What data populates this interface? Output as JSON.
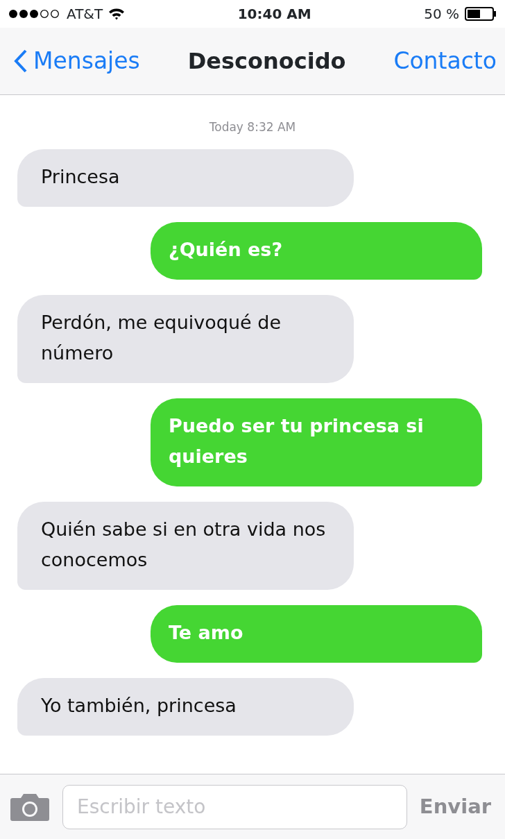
{
  "status_bar": {
    "carrier": "AT&T",
    "time": "10:40 AM",
    "battery": "50 %"
  },
  "nav": {
    "back": "Mensajes",
    "title": "Desconocido",
    "action": "Contacto"
  },
  "timestamp": "Today 8:32 AM",
  "messages": [
    {
      "kind": "incoming",
      "text": "Princesa"
    },
    {
      "kind": "outgoing",
      "text": "¿Quién es?"
    },
    {
      "kind": "incoming",
      "text": "Perdón, me equivoqué de número"
    },
    {
      "kind": "outgoing",
      "text": "Puedo ser tu princesa si quieres"
    },
    {
      "kind": "incoming",
      "text": "Quién sabe si en otra vida nos conocemos"
    },
    {
      "kind": "outgoing",
      "text": "Te amo"
    },
    {
      "kind": "incoming",
      "text": "Yo también, princesa"
    }
  ],
  "composer": {
    "placeholder": "Escribir texto",
    "send": "Enviar"
  }
}
